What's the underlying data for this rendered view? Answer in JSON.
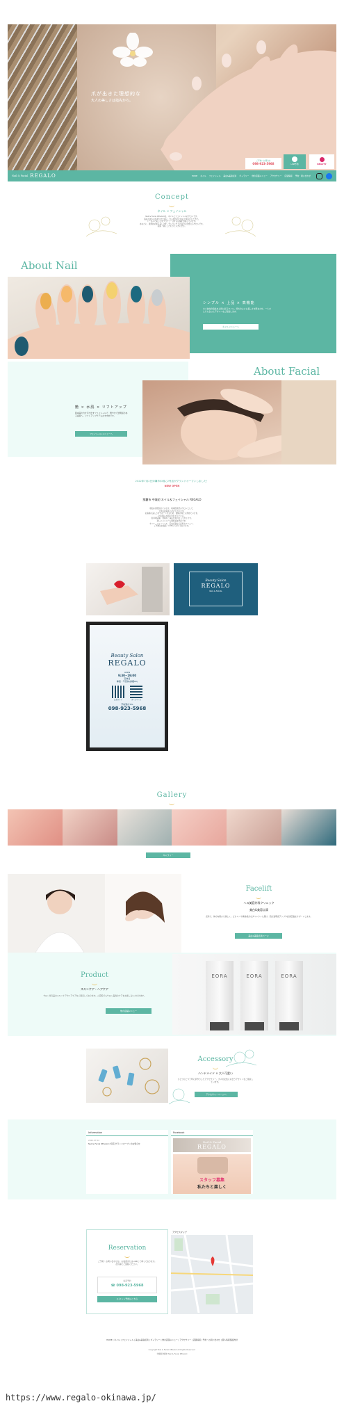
{
  "header": {
    "logo_small": "Nail & Facial",
    "logo_big": "REGALO",
    "nav": [
      "HOME",
      "ネイル",
      "フェイシャル",
      "美白&美容点滴",
      "ギャラリー",
      "他の店舗メニュー",
      "アクセサリー",
      "店舗情報",
      "予約・問い合わせ"
    ],
    "hero_tagline1": "爪が出きた理想的な",
    "hero_tagline2": "大人の美しさは指先から。",
    "cta_tel_label": "ご予約・お問合せ",
    "cta_tel": "098-923-5968",
    "cta_line": "LINE予約",
    "cta_beauty": "BEAUTY"
  },
  "concept": {
    "title": "Concept",
    "subtitle": "ネイル × フェイシャル",
    "text": [
      "Nail & Facial REGALOは、ネイルとフェイシャルのサロンです。",
      "指先と顔への気配りを大切に、大人女性のための上質なひとときを。",
      "トータルで美しさをプロデュースする店舗を目指しています。",
      "あなたに、選択肢のある美しさを。ワンランク上の自分に出会えるサロンです。",
      "指先・顔にこだわりたい方にぜひ。"
    ]
  },
  "about_nail": {
    "title": "About Nail",
    "heading": "シンプル × 上品 × 高機能",
    "text": "大人女性の指先を上質に彩るネイル。持ちのよさと美しさを両立させ、一人ひとりに合ったデザインをご提案します。",
    "button": "ネイルメニューへ"
  },
  "about_facial": {
    "title": "About Facial",
    "heading": "艶 × 水肌 × リフトアップ",
    "text": "肌本来の力を引き出すフェイシャルで、艶やかで透明感のある素肌へ。リフトアップケアもおすすめです。",
    "button": "フェイシャルメニューへ"
  },
  "news": {
    "headline": "2022年7月2日沖縄市中城に2号店がグランドオープンしました！",
    "badge": "NEW OPEN",
    "shop_name": "那覇市 中城初 ネイル＆フェイシャル REGALO",
    "lines": [
      "昭和の雰囲気をそのまま、地域密着型のサロンとして、",
      "丁寧な接客を心がけております。",
      "お客様の美しさをサポートするため、技術の向上に努めています。",
      "お気軽にお問い合わせください。",
      "駐車場完備、皆様のご来店をお待ちしております。",
      "新しいメニューも随時追加予定です。",
      "ネイル、フェイシャル、美白点滴など多彩なメニュー。",
      "ご予約はお電話・LINEにて承っております。"
    ],
    "sign_title": "Beauty Salon",
    "sign_name": "REGALO",
    "sign_sub": "NAIL & FACIAL",
    "poster_title": "Beauty Salon",
    "poster_name": "REGALO",
    "poster_hours_label": "OPEN",
    "poster_hours": "9:30~19:00",
    "poster_closed_label": "定休日",
    "poster_closed": "毎週・不定休(詳細HP)",
    "poster_qr1": "公式サイト",
    "poster_qr2": "ホームページ",
    "poster_tel_label": "予約受付TEL",
    "poster_tel": "098-923-5968"
  },
  "gallery": {
    "title": "Gallery",
    "button": "ギャラリー"
  },
  "facelift": {
    "title": "Facelift",
    "subtitle": "ヘス美容外科クリニック",
    "subtitle2": "美白&美容点滴",
    "text": "点滴で、体の内側から美しく。ビタミンや美容成分をダイレクトに届け、肌の透明感アップや疲労回復をサポートします。",
    "button": "美白&美容点滴ページ"
  },
  "product": {
    "title": "Product",
    "subtitle": "スキンケア・ヘアケア",
    "text": "サロン専売品のスキンケアやヘアケアをご用意しております。ご自宅でもサロン品質のケアをお楽しみいただけます。",
    "button": "他の店舗メニュー",
    "brand": "EORA"
  },
  "accessory": {
    "title": "Accessory",
    "subtitle": "ハンドメイド × 大人可愛い",
    "text": "ひとつひとつ丁寧に手作りしたアクセサリー。大人の女性に似合うデザインをご用意しています。",
    "button": "アクセサリーページへ"
  },
  "info": {
    "info_title": "Information",
    "info_date": "2022.07.02",
    "info_text": "Nail & Facial REGALO 2号店 グランドオープンのお知らせ",
    "fb_title": "Facebook",
    "fb_banner1": "Nail & Facial",
    "fb_banner2": "REGALO",
    "fb_text1": "スタッフ募集",
    "fb_text2": "私たちと楽しく"
  },
  "reservation": {
    "title": "Reservation",
    "text": "ご予約・お問い合わせは、お電話またはLINEにて承っております。お気軽にご連絡ください。",
    "tel_label": "電話予約",
    "tel": "098-923-5968",
    "line": "ネット予約はこちら",
    "map_label": "アクセスマップ"
  },
  "footer": {
    "nav": "HOME | ネイル | フェイシャル | 美白&美容点滴 | ギャラリー | 他の店舗メニュー | アクセサリー | 店舗情報 | 予約・お問い合わせ | 個人情報保護方針",
    "copyright": "Copyright Nail & Facial REGALO All Rights Reserved.",
    "address": "沖縄県沖縄市 Nail & Facial REGALO"
  },
  "url_caption": "https://www.regalo-okinawa.jp/",
  "colors": {
    "accent": "#5cb6a3",
    "mint": "#eefbf8"
  }
}
